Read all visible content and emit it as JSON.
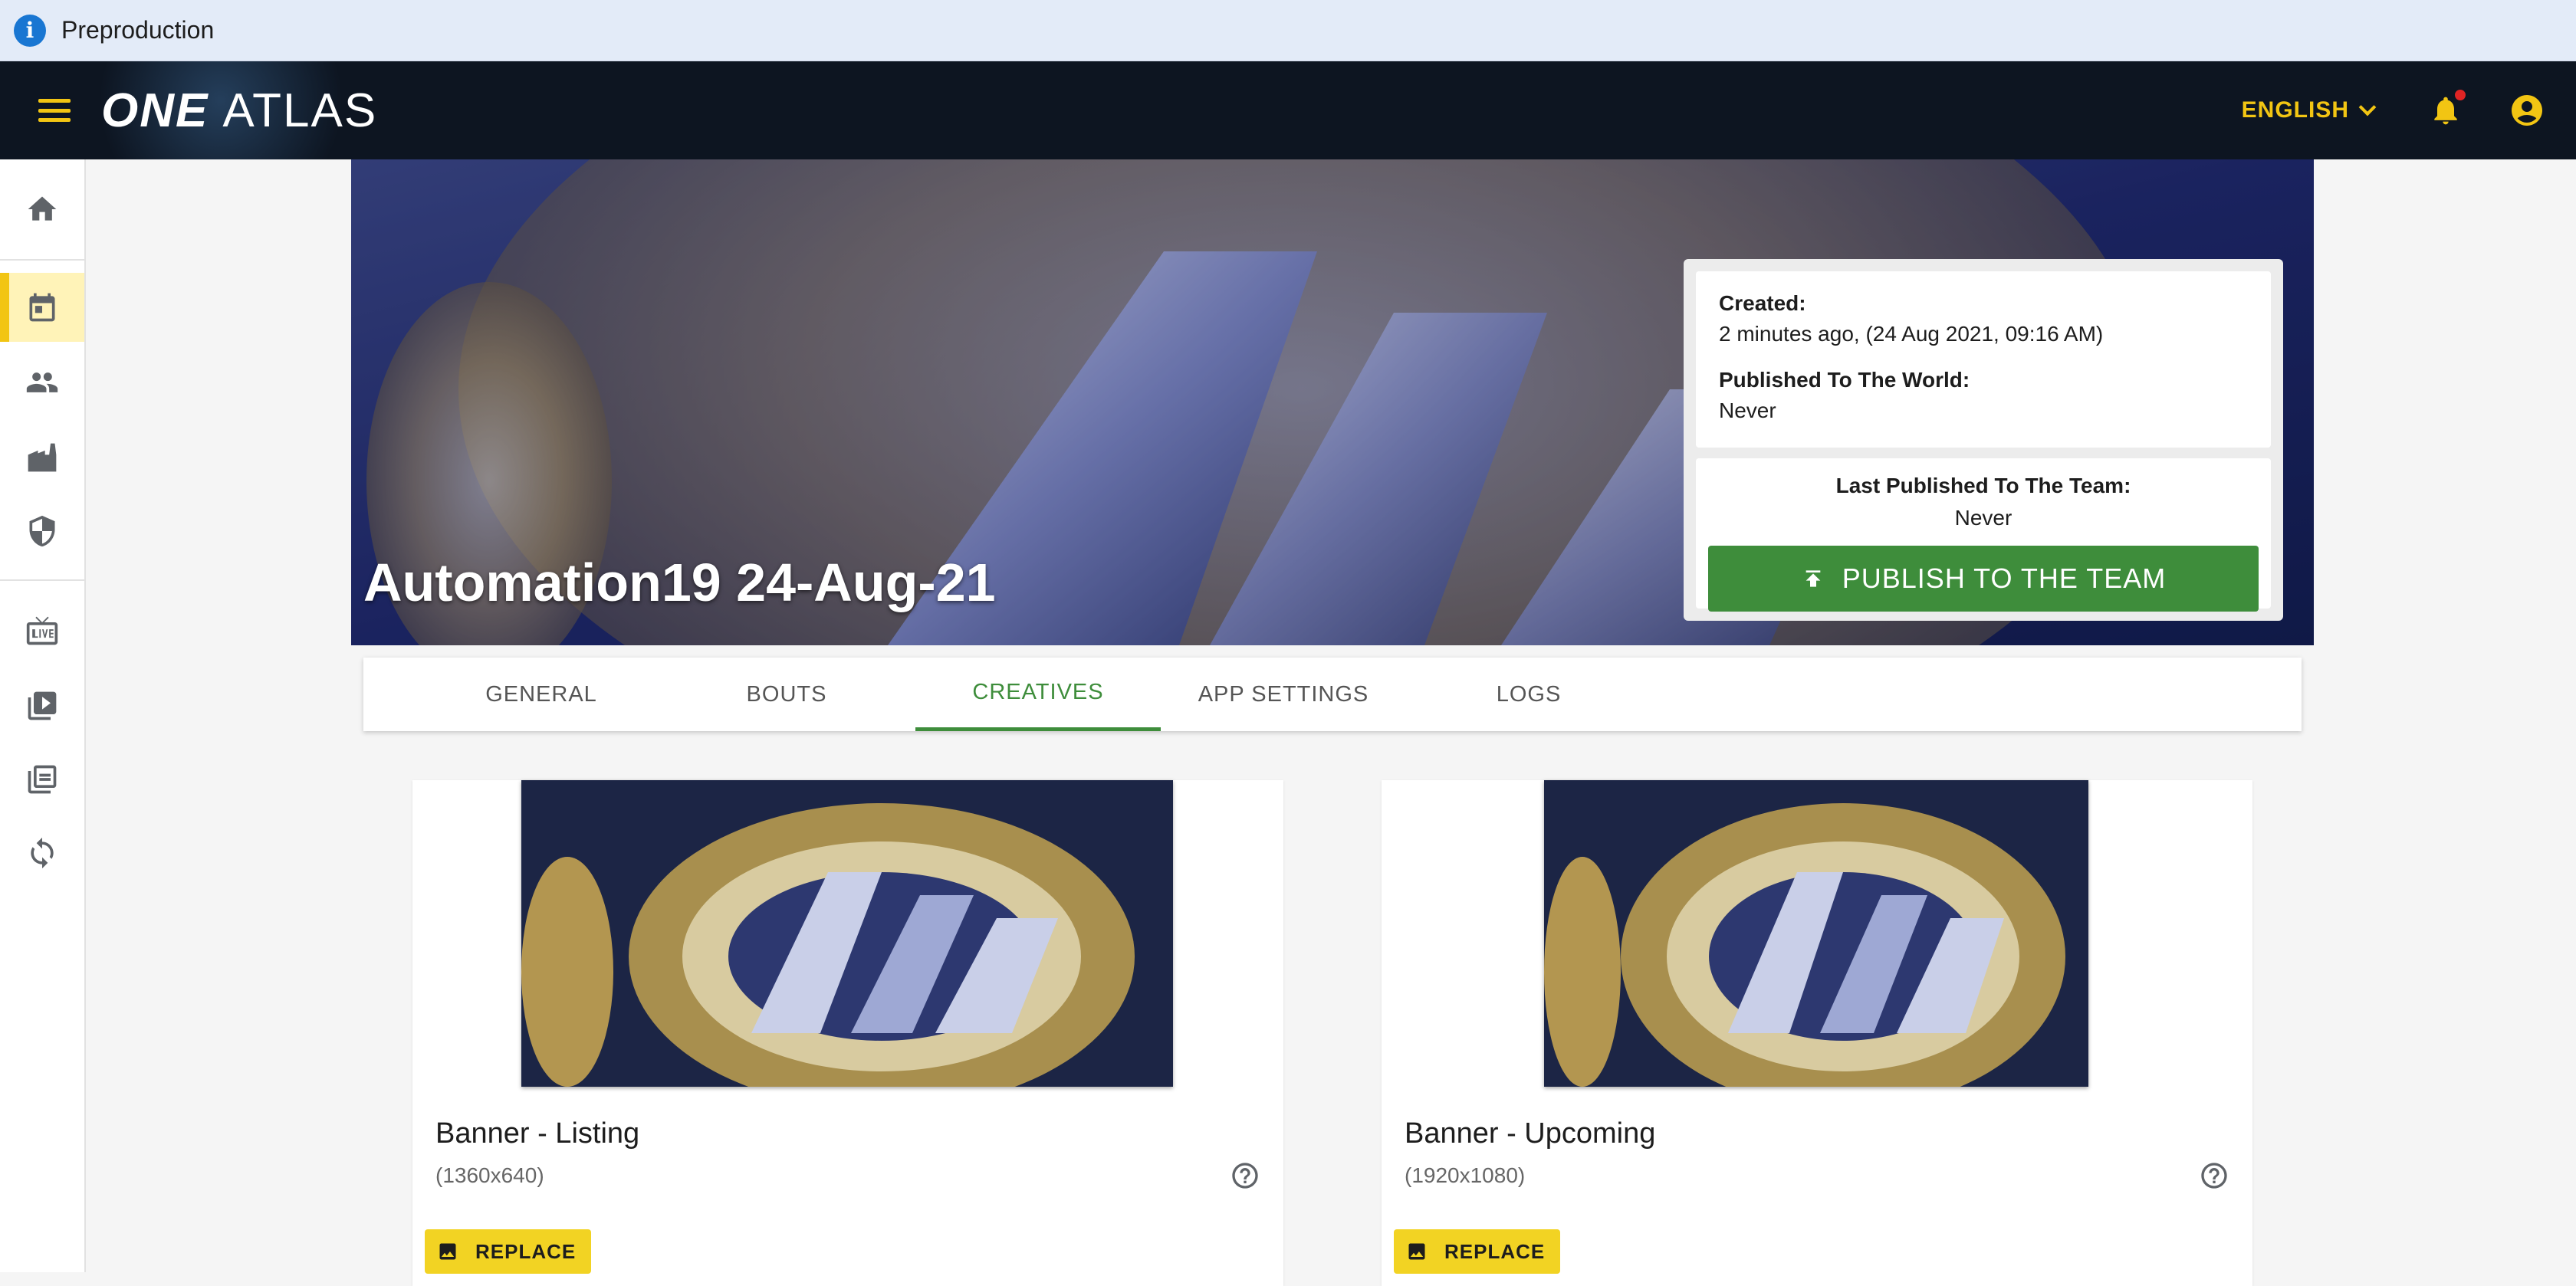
{
  "env_bar": {
    "label": "Preproduction",
    "icon": "info-icon"
  },
  "topnav": {
    "logo_one": "ONE",
    "logo_atlas": "ATLAS",
    "language": "ENGLISH",
    "has_notification": true
  },
  "sidebar": {
    "items": [
      {
        "name": "home",
        "icon": "home-icon"
      },
      {
        "name": "events",
        "icon": "calendar-icon",
        "active": true
      },
      {
        "name": "athletes",
        "icon": "people-icon"
      },
      {
        "name": "organizations",
        "icon": "factory-icon"
      },
      {
        "name": "brands",
        "icon": "shield-icon"
      },
      {
        "name": "live",
        "icon": "live-tv-icon"
      },
      {
        "name": "videos",
        "icon": "video-library-icon"
      },
      {
        "name": "collections",
        "icon": "collections-icon"
      },
      {
        "name": "sync",
        "icon": "sync-icon"
      }
    ]
  },
  "hero": {
    "title": "Automation19 24-Aug-21",
    "created_label": "Created:",
    "created_value": "2 minutes ago, (24 Aug 2021, 09:16 AM)",
    "published_world_label": "Published To The World:",
    "published_world_value": "Never",
    "last_published_team_label": "Last Published To The Team:",
    "last_published_team_value": "Never",
    "publish_button": "PUBLISH TO THE TEAM"
  },
  "tabs": [
    {
      "label": "GENERAL"
    },
    {
      "label": "BOUTS"
    },
    {
      "label": "CREATIVES",
      "active": true
    },
    {
      "label": "APP SETTINGS"
    },
    {
      "label": "LOGS"
    }
  ],
  "cards": [
    {
      "title": "Banner - Listing",
      "size": "(1360x640)",
      "replace_label": "REPLACE"
    },
    {
      "title": "Banner - Upcoming",
      "size": "(1920x1080)",
      "replace_label": "REPLACE"
    }
  ],
  "colors": {
    "accent_yellow": "#f2c513",
    "publish_green": "#3e8d3b",
    "nav_dark": "#0d1521",
    "info_blue": "#1976d2"
  }
}
